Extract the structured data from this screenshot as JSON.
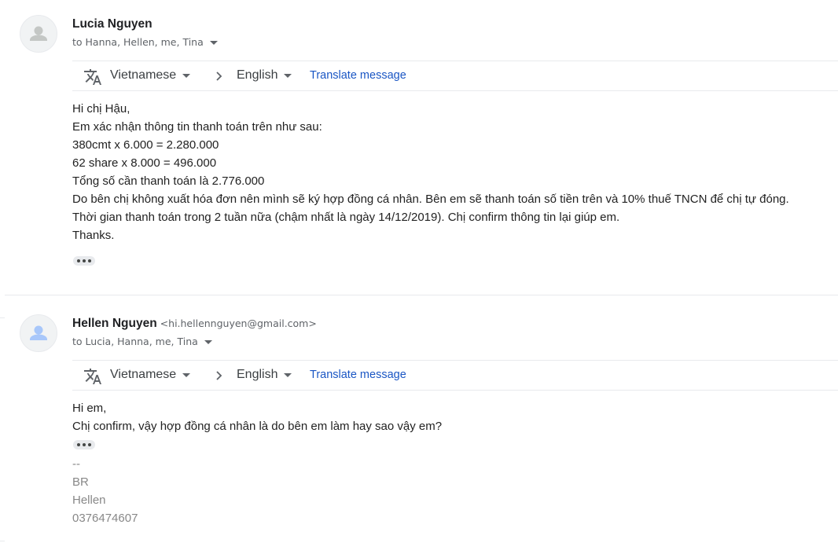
{
  "messages": [
    {
      "sender_name": "Lucia Nguyen",
      "sender_email": "",
      "recipients": "to Hanna, Hellen, me, Tina",
      "translate": {
        "from_lang": "Vietnamese",
        "to_lang": "English",
        "action": "Translate message"
      },
      "body": [
        "Hi chị Hậu,",
        "Em xác nhận thông tin thanh toán trên như sau:",
        "380cmt x 6.000 = 2.280.000",
        "62 share x 8.000 = 496.000",
        "Tổng số cần thanh toán là 2.776.000",
        "Do bên chị không xuất hóa đơn nên mình sẽ ký hợp đồng cá nhân. Bên em sẽ thanh toán số tiền trên và 10% thuế TNCN để chị tự đóng.",
        "Thời gian thanh toán trong 2 tuần nữa (chậm nhất là ngày 14/12/2019). Chị confirm thông tin lại giúp em.",
        "Thanks."
      ]
    },
    {
      "sender_name": "Hellen Nguyen",
      "sender_email": "<hi.hellennguyen@gmail.com>",
      "recipients": "to Lucia, Hanna, me, Tina",
      "translate": {
        "from_lang": "Vietnamese",
        "to_lang": "English",
        "action": "Translate message"
      },
      "body": [
        "Hi em,",
        "Chị confirm, vậy hợp đồng cá nhân là do bên em làm hay sao vậy em?"
      ],
      "signature": [
        "--",
        "BR",
        "Hellen",
        "0376474607"
      ]
    }
  ],
  "icons": {
    "avatar": "person-icon",
    "translate": "translate-icon",
    "chevron": "chevron-right-icon",
    "dropdown": "caret-down-icon",
    "trimmed": "more-horiz-icon"
  },
  "colors": {
    "link": "#1a56c4",
    "avatar_fg_1": "#c4c7c5",
    "avatar_fg_2": "#a8c7fa",
    "signature": "#888888"
  }
}
